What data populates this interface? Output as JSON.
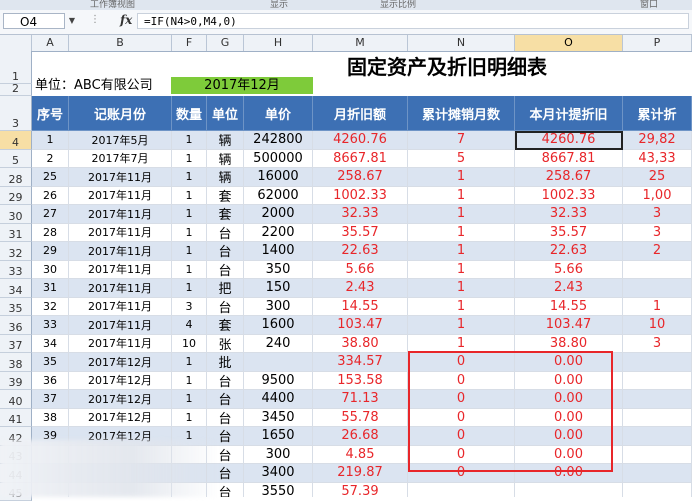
{
  "ribbon_groups": [
    "工作簿视图",
    "显示",
    "显示比例",
    "窗口"
  ],
  "name_box": "O4",
  "fx_symbol": "fx",
  "formula": "=IF(N4>0,M4,0)",
  "columns": [
    "A",
    "B",
    "F",
    "G",
    "H",
    "M",
    "N",
    "O",
    "P"
  ],
  "selected_column": "O",
  "title": "固定资产及折旧明细表",
  "unit_label": "单位：ABC有限公司",
  "period": "2017年12月",
  "headers": [
    "序号",
    "记账月份",
    "数量",
    "单位",
    "单价",
    "月折旧额",
    "累计摊销月数",
    "本月计提折旧",
    "累计折"
  ],
  "row_numbers": [
    "1",
    "2",
    "3",
    "4",
    "5",
    "28",
    "29",
    "30",
    "31",
    "32",
    "33",
    "34",
    "35",
    "36",
    "37",
    "38",
    "39",
    "40",
    "41",
    "42",
    "43",
    "44",
    "45"
  ],
  "selected_row": "4",
  "rows": [
    {
      "a": "1",
      "b": "2017年5月",
      "f": "1",
      "g": "辆",
      "h": "242800",
      "m": "4260.76",
      "n": "7",
      "o": "4260.76",
      "p": "29,82"
    },
    {
      "a": "2",
      "b": "2017年7月",
      "f": "1",
      "g": "辆",
      "h": "500000",
      "m": "8667.81",
      "n": "5",
      "o": "8667.81",
      "p": "43,33"
    },
    {
      "a": "25",
      "b": "2017年11月",
      "f": "1",
      "g": "辆",
      "h": "16000",
      "m": "258.67",
      "n": "1",
      "o": "258.67",
      "p": "25"
    },
    {
      "a": "26",
      "b": "2017年11月",
      "f": "1",
      "g": "套",
      "h": "62000",
      "m": "1002.33",
      "n": "1",
      "o": "1002.33",
      "p": "1,00"
    },
    {
      "a": "27",
      "b": "2017年11月",
      "f": "1",
      "g": "套",
      "h": "2000",
      "m": "32.33",
      "n": "1",
      "o": "32.33",
      "p": "3"
    },
    {
      "a": "28",
      "b": "2017年11月",
      "f": "1",
      "g": "台",
      "h": "2200",
      "m": "35.57",
      "n": "1",
      "o": "35.57",
      "p": "3"
    },
    {
      "a": "29",
      "b": "2017年11月",
      "f": "1",
      "g": "台",
      "h": "1400",
      "m": "22.63",
      "n": "1",
      "o": "22.63",
      "p": "2"
    },
    {
      "a": "30",
      "b": "2017年11月",
      "f": "1",
      "g": "台",
      "h": "350",
      "m": "5.66",
      "n": "1",
      "o": "5.66",
      "p": ""
    },
    {
      "a": "31",
      "b": "2017年11月",
      "f": "1",
      "g": "把",
      "h": "150",
      "m": "2.43",
      "n": "1",
      "o": "2.43",
      "p": ""
    },
    {
      "a": "32",
      "b": "2017年11月",
      "f": "3",
      "g": "台",
      "h": "300",
      "m": "14.55",
      "n": "1",
      "o": "14.55",
      "p": "1"
    },
    {
      "a": "33",
      "b": "2017年11月",
      "f": "4",
      "g": "套",
      "h": "1600",
      "m": "103.47",
      "n": "1",
      "o": "103.47",
      "p": "10"
    },
    {
      "a": "34",
      "b": "2017年11月",
      "f": "10",
      "g": "张",
      "h": "240",
      "m": "38.80",
      "n": "1",
      "o": "38.80",
      "p": "3"
    },
    {
      "a": "35",
      "b": "2017年12月",
      "f": "1",
      "g": "批",
      "h": "",
      "m": "334.57",
      "n": "0",
      "o": "0.00",
      "p": ""
    },
    {
      "a": "36",
      "b": "2017年12月",
      "f": "1",
      "g": "台",
      "h": "9500",
      "m": "153.58",
      "n": "0",
      "o": "0.00",
      "p": ""
    },
    {
      "a": "37",
      "b": "2017年12月",
      "f": "1",
      "g": "台",
      "h": "4400",
      "m": "71.13",
      "n": "0",
      "o": "0.00",
      "p": ""
    },
    {
      "a": "38",
      "b": "2017年12月",
      "f": "1",
      "g": "台",
      "h": "3450",
      "m": "55.78",
      "n": "0",
      "o": "0.00",
      "p": ""
    },
    {
      "a": "39",
      "b": "2017年12月",
      "f": "1",
      "g": "台",
      "h": "1650",
      "m": "26.68",
      "n": "0",
      "o": "0.00",
      "p": ""
    },
    {
      "a": "",
      "b": "",
      "f": "",
      "g": "台",
      "h": "300",
      "m": "4.85",
      "n": "0",
      "o": "0.00",
      "p": ""
    },
    {
      "a": "",
      "b": "",
      "f": "",
      "g": "台",
      "h": "3400",
      "m": "219.87",
      "n": "0",
      "o": "0.00",
      "p": ""
    },
    {
      "a": "",
      "b": "",
      "f": "",
      "g": "台",
      "h": "3550",
      "m": "57.39",
      "n": "",
      "o": "",
      "p": ""
    }
  ]
}
